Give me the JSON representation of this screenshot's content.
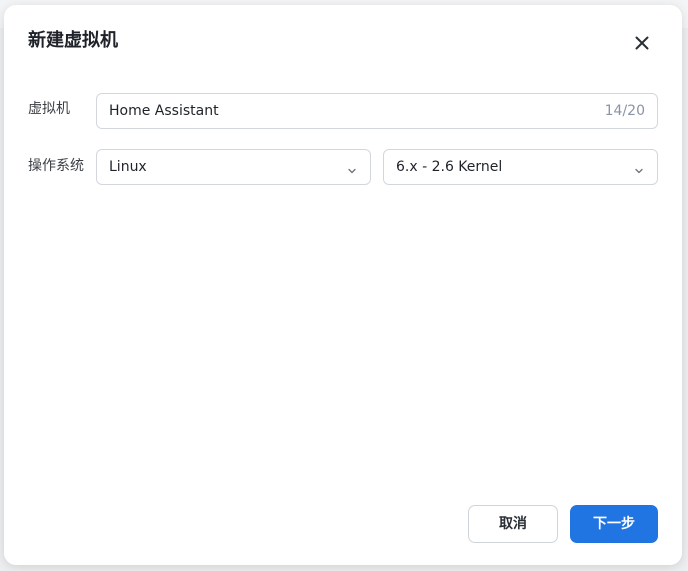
{
  "dialog": {
    "title": "新建虚拟机",
    "close_icon": "close-icon"
  },
  "form": {
    "name_label": "虚拟机",
    "name_value": "Home Assistant",
    "name_counter": "14/20",
    "os_label": "操作系统",
    "os_family_value": "Linux",
    "os_version_value": "6.x - 2.6 Kernel",
    "dropdown_icon": "chevron-down-icon"
  },
  "footer": {
    "cancel_label": "取消",
    "next_label": "下一步"
  },
  "colors": {
    "primary": "#2175e3",
    "text": "#1f2329",
    "border": "#d3d7dd",
    "counter": "#8a94a6"
  }
}
